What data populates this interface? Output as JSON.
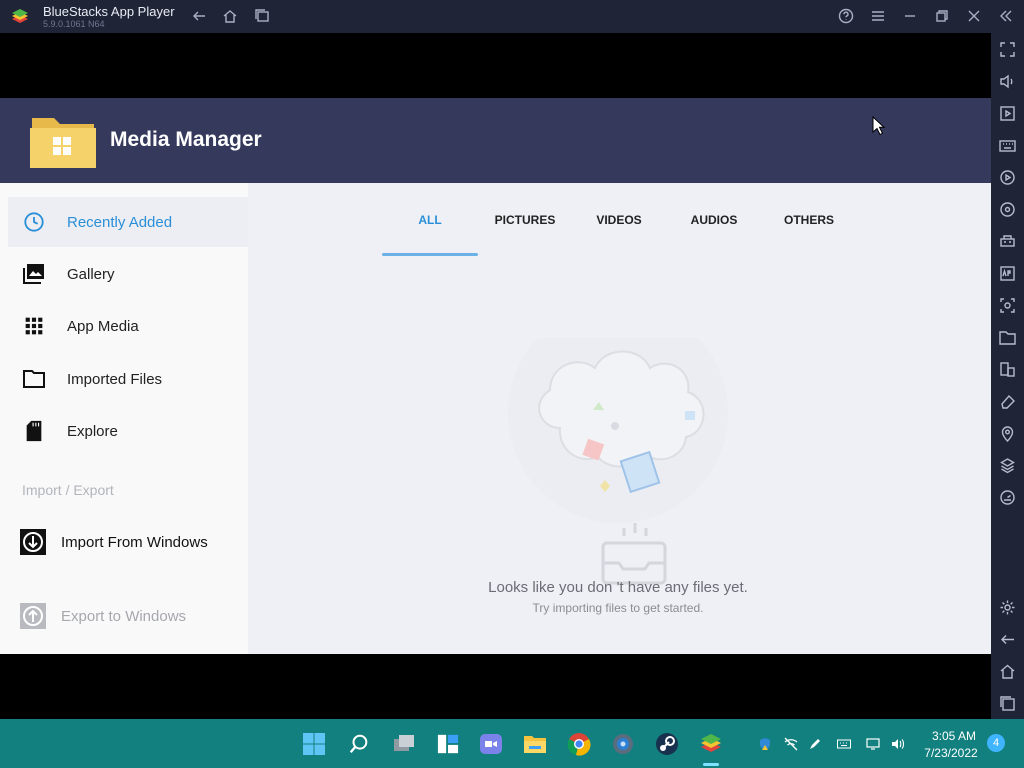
{
  "window": {
    "title": "BlueStacks App Player",
    "version": "5.9.0.1061 N64"
  },
  "app": {
    "name": "Media Manager"
  },
  "sidebar": {
    "items": [
      {
        "label": "Recently Added"
      },
      {
        "label": "Gallery"
      },
      {
        "label": "App Media"
      },
      {
        "label": "Imported Files"
      },
      {
        "label": "Explore"
      }
    ],
    "section_label": "Import / Export",
    "import_label": "Import From Windows",
    "export_label": "Export to Windows"
  },
  "tabs": [
    {
      "label": "ALL"
    },
    {
      "label": "PICTURES"
    },
    {
      "label": "VIDEOS"
    },
    {
      "label": "AUDIOS"
    },
    {
      "label": "OTHERS"
    }
  ],
  "empty_state": {
    "message": "Looks like you don 't have any files yet.",
    "hint": "Try importing files to get started."
  },
  "taskbar": {
    "time": "3:05 AM",
    "date": "7/23/2022",
    "notification_count": "4"
  },
  "colors": {
    "accent": "#2a8fd8",
    "header": "#353a5c",
    "chrome": "#1f2436",
    "taskbar": "#12807f"
  }
}
